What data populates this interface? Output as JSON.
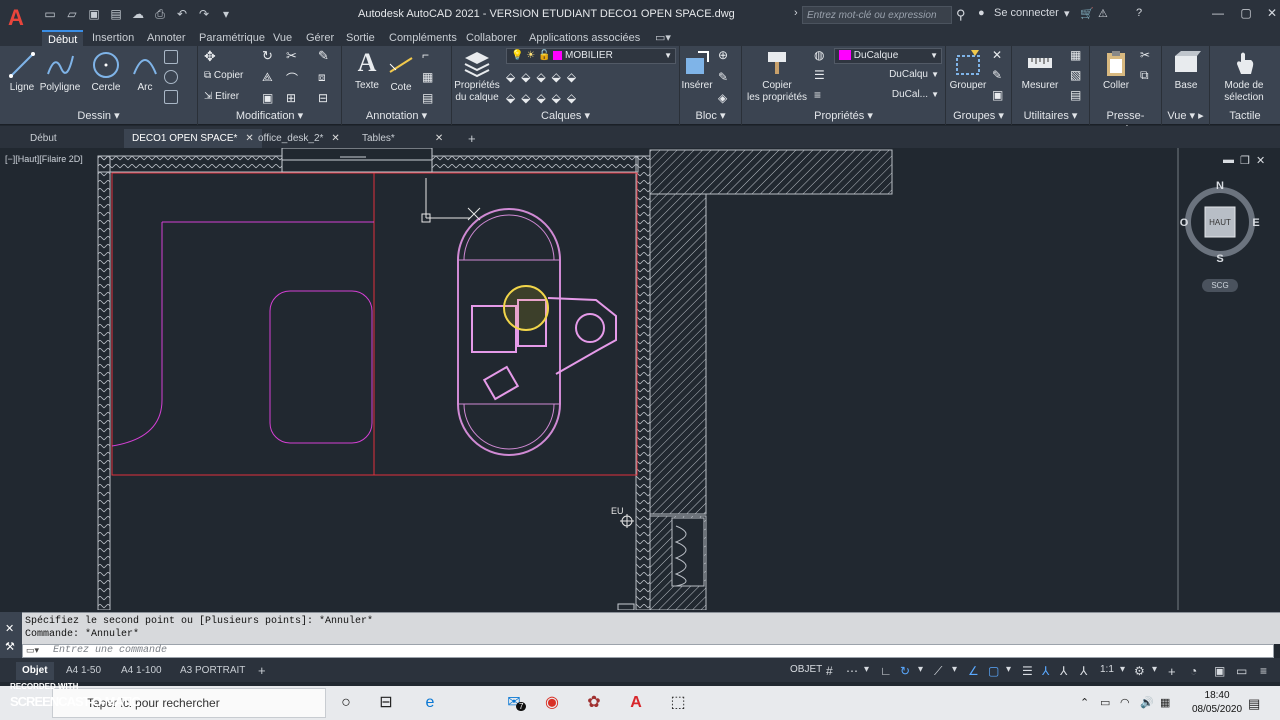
{
  "title": {
    "text": "Autodesk AutoCAD 2021 - VERSION ETUDIANT    DECO1 OPEN SPACE.dwg",
    "search_placeholder": "Entrez mot-clé ou expression",
    "signin": "Se connecter"
  },
  "ribbon_tabs": [
    "Début",
    "Insertion",
    "Annoter",
    "Paramétrique",
    "Vue",
    "Gérer",
    "Sortie",
    "Compléments",
    "Collaborer",
    "Applications associées"
  ],
  "ribbon": {
    "dessin": {
      "title": "Dessin",
      "ligne": "Ligne",
      "polyligne": "Polyligne",
      "cercle": "Cercle",
      "arc": "Arc"
    },
    "modification": {
      "title": "Modification",
      "copier": "Copier",
      "etirer": "Etirer"
    },
    "annotation": {
      "title": "Annotation",
      "texte": "Texte",
      "cote": "Cote"
    },
    "calques": {
      "title": "Calques",
      "proprietes1": "Propriétés",
      "proprietes2": "du calque",
      "current_layer": "MOBILIER",
      "layer_color": "#ff00ff"
    },
    "bloc": {
      "title": "Bloc",
      "inserer": "Insérer"
    },
    "proprietes": {
      "title": "Propriétés",
      "copier1": "Copier",
      "copier2": "les propriétés",
      "color": "DuCalque",
      "linetype": "DuCalqu",
      "lineweight": "DuCal..."
    },
    "groupes": {
      "title": "Groupes",
      "grouper": "Grouper"
    },
    "utilitaires": {
      "title": "Utilitaires",
      "mesurer": "Mesurer"
    },
    "presse": {
      "title": "Presse-papiers",
      "coller": "Coller"
    },
    "vue": {
      "title": "Vue",
      "base": "Base"
    },
    "tactile": {
      "title": "Tactile",
      "mode1": "Mode de",
      "mode2": "sélection"
    }
  },
  "doc_tabs": [
    {
      "label": "Début",
      "active": false,
      "closable": false
    },
    {
      "label": "DECO1 OPEN SPACE*",
      "active": true,
      "closable": true
    },
    {
      "label": "office_desk_2*",
      "active": false,
      "closable": true
    },
    {
      "label": "Tables*",
      "active": false,
      "closable": true
    }
  ],
  "viewport": {
    "label": "[−][Haut][Filaire 2D]",
    "eu_label": "EU",
    "viewcube": {
      "n": "N",
      "s": "S",
      "e": "E",
      "w": "O",
      "face": "HAUT",
      "wcs": "SCG"
    }
  },
  "command": {
    "history": [
      "Spécifiez le second point ou [Plusieurs points]: *Annuler*",
      "Commande: *Annuler*"
    ],
    "placeholder": "Entrez une commande"
  },
  "layout_tabs": [
    {
      "label": "Objet",
      "active": true
    },
    {
      "label": "A4 1-50",
      "active": false
    },
    {
      "label": "A4 1-100",
      "active": false
    },
    {
      "label": "A3 PORTRAIT",
      "active": false
    }
  ],
  "status": {
    "model": "OBJET",
    "scale": "1:1"
  },
  "taskbar": {
    "search": "Taper ici pour rechercher",
    "time": "18:40",
    "date": "08/05/2020",
    "mail_count": "7"
  },
  "watermark": {
    "line1": "RECORDED WITH",
    "line2": "SCREENCAST-O-MATIC"
  }
}
